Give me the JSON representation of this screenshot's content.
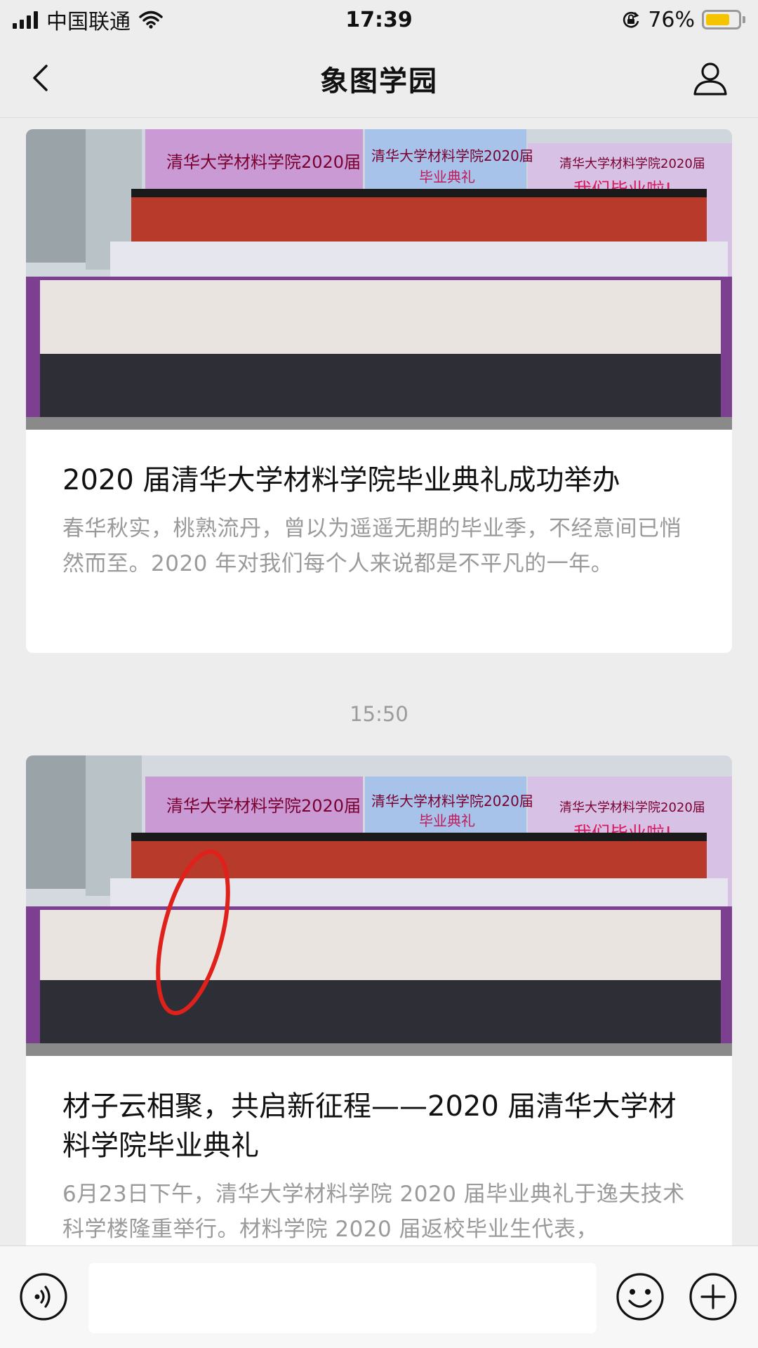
{
  "status_bar": {
    "carrier": "中国联通",
    "time": "17:39",
    "battery_percent": "76%",
    "battery_level": 0.76,
    "battery_color": "#f5c400"
  },
  "nav": {
    "title": "象图学园",
    "back_icon": "chevron-left-icon",
    "profile_icon": "person-icon"
  },
  "feed": {
    "articles": [
      {
        "title": "2020 届清华大学材料学院毕业典礼成功举办",
        "summary": "春华秋实，桃熟流丹，曾以为遥遥无期的毕业季，不经意间已悄然而至。2020 年对我们每个人来说都是不平凡的一年。",
        "photo_banners": [
          "清华大学材料学院2020届",
          "清华大学材料学院2020届",
          "毕业典礼",
          "清华大学材料学院2020届",
          "我们毕业啦!"
        ]
      },
      {
        "title": "材子云相聚，共启新征程——2020 届清华大学材料学院毕业典礼",
        "summary": "6月23日下午，清华大学材料学院 2020 届毕业典礼于逸夫技术科学楼隆重举行。材料学院 2020 届返校毕业生代表，",
        "photo_banners": [
          "清华大学材料学院2020届",
          "清华大学材料学院2020届",
          "毕业典礼",
          "清华大学材料学院2020届",
          "我们毕业啦!"
        ]
      }
    ],
    "timestamp": "15:50"
  },
  "input_bar": {
    "placeholder": "",
    "voice_icon": "voice-icon",
    "emoji_icon": "emoji-icon",
    "plus_icon": "plus-icon"
  }
}
